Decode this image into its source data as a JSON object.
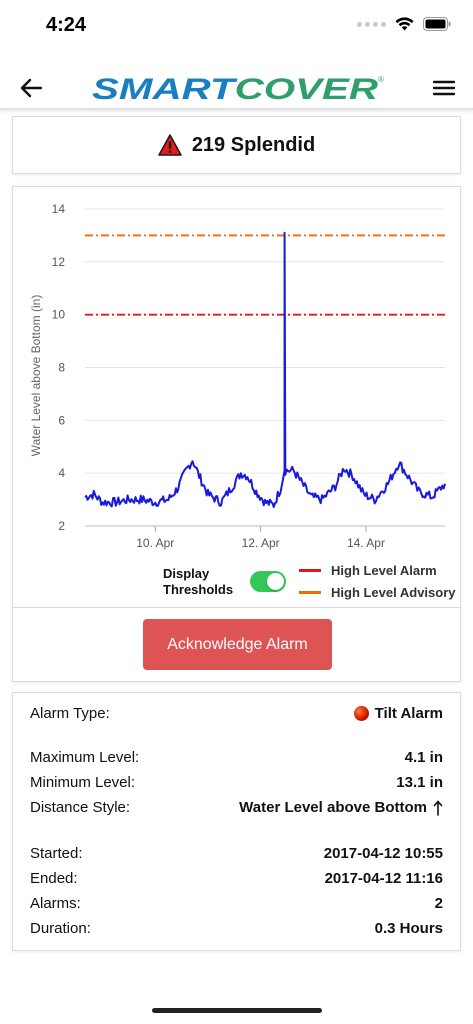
{
  "status_bar": {
    "time": "4:24"
  },
  "nav": {
    "logo_text_a": "SMART",
    "logo_text_b": "COVER",
    "logo_registered": "®",
    "brand_color": "#1a7fc1",
    "brand_green": "#2e9e6a"
  },
  "site": {
    "name": "219 Splendid"
  },
  "chart_data": {
    "type": "line",
    "ylabel": "Water Level above Bottom (in)",
    "ylim": [
      2,
      14
    ],
    "yticks": [
      "2",
      "4",
      "6",
      "8",
      "10",
      "12",
      "14"
    ],
    "xticks": [
      "10. Apr",
      "12. Apr",
      "14. Apr"
    ],
    "x_range": [
      "2017-04-08 16:00",
      "2017-04-15 12:00"
    ],
    "grid": true,
    "series": [
      {
        "name": "",
        "color": "#1a1adc",
        "points": [
          [
            "2017-04-08 16:00",
            3.1
          ],
          [
            "2017-04-08 20:00",
            3.2
          ],
          [
            "2017-04-09 00:00",
            2.9
          ],
          [
            "2017-04-09 06:00",
            2.9
          ],
          [
            "2017-04-09 12:00",
            3.0
          ],
          [
            "2017-04-09 18:00",
            3.0
          ],
          [
            "2017-04-10 00:00",
            2.9
          ],
          [
            "2017-04-10 06:00",
            3.0
          ],
          [
            "2017-04-10 10:00",
            3.4
          ],
          [
            "2017-04-10 14:00",
            4.1
          ],
          [
            "2017-04-10 17:00",
            4.5
          ],
          [
            "2017-04-10 20:00",
            3.9
          ],
          [
            "2017-04-11 00:00",
            3.2
          ],
          [
            "2017-04-11 06:00",
            2.9
          ],
          [
            "2017-04-11 12:00",
            3.6
          ],
          [
            "2017-04-11 15:00",
            4.0
          ],
          [
            "2017-04-11 18:00",
            3.9
          ],
          [
            "2017-04-11 22:00",
            3.3
          ],
          [
            "2017-04-12 02:00",
            2.9
          ],
          [
            "2017-04-12 06:00",
            2.8
          ],
          [
            "2017-04-12 09:00",
            3.4
          ],
          [
            "2017-04-12 10:54",
            4.1
          ],
          [
            "2017-04-12 10:55",
            13.1
          ],
          [
            "2017-04-12 11:16",
            4.1
          ],
          [
            "2017-04-12 15:00",
            4.1
          ],
          [
            "2017-04-12 19:00",
            3.6
          ],
          [
            "2017-04-12 23:00",
            3.1
          ],
          [
            "2017-04-13 04:00",
            3.0
          ],
          [
            "2017-04-13 10:00",
            3.5
          ],
          [
            "2017-04-13 14:00",
            4.2
          ],
          [
            "2017-04-13 18:00",
            3.9
          ],
          [
            "2017-04-13 23:00",
            3.2
          ],
          [
            "2017-04-14 04:00",
            3.0
          ],
          [
            "2017-04-14 10:00",
            3.6
          ],
          [
            "2017-04-14 15:00",
            4.4
          ],
          [
            "2017-04-14 19:00",
            3.9
          ],
          [
            "2017-04-15 00:00",
            3.3
          ],
          [
            "2017-04-15 06:00",
            3.1
          ],
          [
            "2017-04-15 12:00",
            3.6
          ]
        ]
      }
    ],
    "thresholds": [
      {
        "name": "High Level Alarm",
        "value": 10,
        "color": "#e01818"
      },
      {
        "name": "High Level Advisory",
        "value": 13,
        "color": "#ef6c00"
      }
    ]
  },
  "controls": {
    "display_thresholds": "Display Thresholds",
    "thresholds_on": true,
    "acknowledge": "Acknowledge Alarm"
  },
  "info": {
    "alarm_type_label": "Alarm Type:",
    "alarm_type_value": "Tilt Alarm",
    "max_label": "Maximum Level:",
    "max_value": "4.1 in",
    "min_label": "Minimum Level:",
    "min_value": "13.1 in",
    "distance_label": "Distance Style:",
    "distance_value": "Water Level above Bottom",
    "started_label": "Started:",
    "started_value": "2017-04-12 10:55",
    "ended_label": "Ended:",
    "ended_value": "2017-04-12 11:16",
    "alarms_label": "Alarms:",
    "alarms_value": "2",
    "duration_label": "Duration:",
    "duration_value": "0.3 Hours"
  }
}
